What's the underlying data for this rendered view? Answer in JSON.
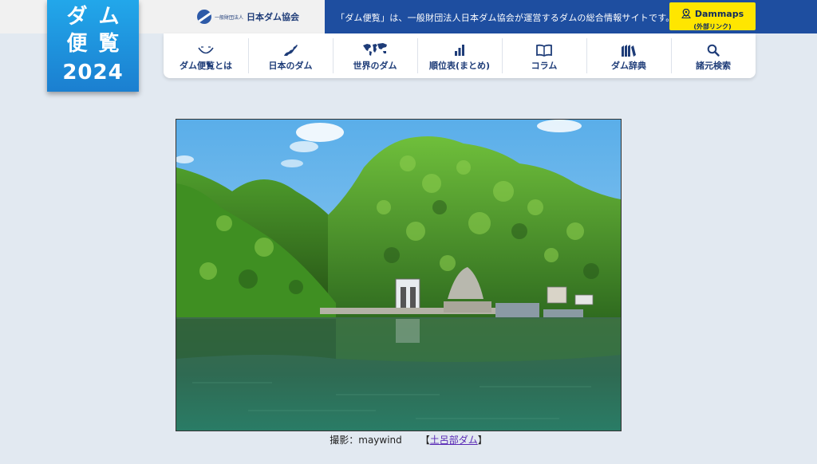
{
  "logo": {
    "line1": "ダム",
    "line2": "便覧",
    "line3": "2024"
  },
  "association": {
    "prefix": "一般財団法人",
    "name": "日本ダム協会"
  },
  "tagline": "「ダム便覧」は、一般財団法人日本ダム協会が運営するダムの総合情報サイトです。",
  "dammaps": {
    "title": "Dammaps",
    "subtitle": "(外部リンク)",
    "icon": "map-pin-icon"
  },
  "nav": {
    "items": [
      {
        "label": "ダム便覧とは",
        "icon": "dam-curve-icon"
      },
      {
        "label": "日本のダム",
        "icon": "japan-map-icon"
      },
      {
        "label": "世界のダム",
        "icon": "world-map-icon"
      },
      {
        "label": "順位表(まとめ)",
        "icon": "bar-chart-icon"
      },
      {
        "label": "コラム",
        "icon": "book-icon"
      },
      {
        "label": "ダム辞典",
        "icon": "books-icon"
      },
      {
        "label": "諸元検索",
        "icon": "search-icon"
      }
    ]
  },
  "photo": {
    "subject": "dam reservoir with green mountains"
  },
  "caption": {
    "credit": "撮影：maywind",
    "open_bracket": "【",
    "link": "土呂部ダム",
    "close_bracket": "】"
  },
  "colors": {
    "header_blue": "#1e4ea0",
    "logo_blue": "#1b8fdc",
    "dammaps_yellow": "#ffe600",
    "nav_text": "#1e3c78",
    "background": "#e2e9f1"
  }
}
